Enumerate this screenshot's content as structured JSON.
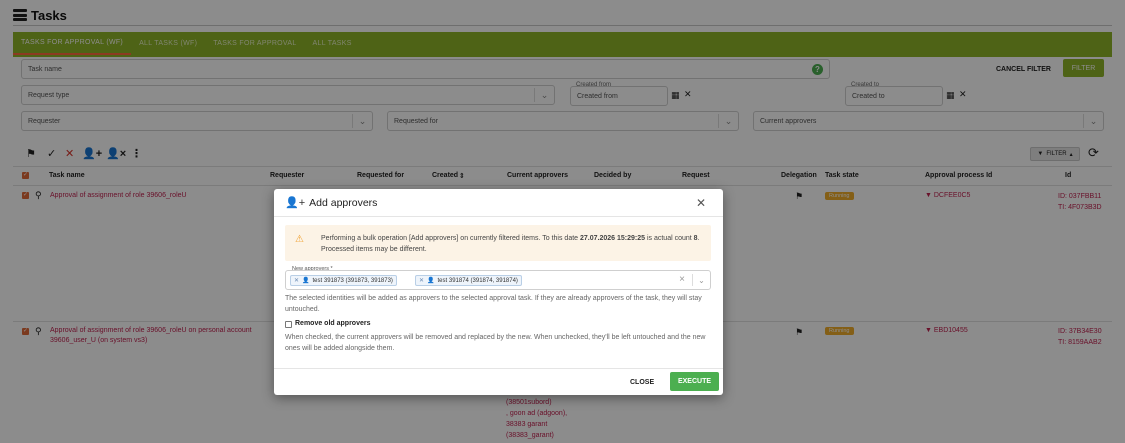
{
  "page": {
    "title": "Tasks",
    "title_icon": "tasks-list-icon"
  },
  "tabs": [
    {
      "label": "TASKS FOR APPROVAL (WF)",
      "active": true
    },
    {
      "label": "ALL TASKS (WF)",
      "active": false
    },
    {
      "label": "TASKS FOR APPROVAL",
      "active": false
    },
    {
      "label": "ALL TASKS",
      "active": false
    }
  ],
  "filters": {
    "task_name_placeholder": "Task name",
    "request_type_placeholder": "Request type",
    "created_from_label": "Created from",
    "created_from_placeholder": "Created from",
    "created_to_label": "Created to",
    "created_to_placeholder": "Created to",
    "requester_placeholder": "Requester",
    "requested_for_placeholder": "Requested for",
    "current_approvers_placeholder": "Current approvers",
    "cancel_filter_label": "CANCEL FILTER",
    "filter_button_label": "FILTER",
    "help_glyph": "?"
  },
  "toolbar": {
    "filter_toggle_label": "FILTER"
  },
  "table": {
    "headers": {
      "task_name": "Task name",
      "requester": "Requester",
      "requested_for": "Requested for",
      "created": "Created",
      "current_approvers": "Current approvers",
      "decided_by": "Decided by",
      "request": "Request",
      "delegation": "Delegation",
      "task_state": "Task state",
      "approval_process_id": "Approval process Id",
      "id": "Id"
    },
    "rows": [
      {
        "task_name": "Approval of assignment of role 39606_roleU",
        "state": "Running",
        "process_id": "DCFEE0C5",
        "id_line": "ID: 037FBB11",
        "ti_line": "TI: 4F073B3D"
      },
      {
        "task_name_line1": "Approval of assignment of role 39606_roleU on personal account",
        "task_name_line2": "39606_user_U (on system vs3)",
        "state": "Running",
        "process_id": "EBD10455",
        "id_line": "ID: 37B34E30",
        "ti_line": "TI: 8159AAB2"
      }
    ],
    "approvers_tail": [
      "(38501subord)",
      ", goon ad (adgoon),",
      "38383 garant",
      "(38383_garant)"
    ]
  },
  "modal": {
    "title": "Add approvers",
    "alert_text_before": "Performing a bulk operation [Add approvers] on currently filtered items. To this date ",
    "alert_date": "27.07.2026 15:29:25",
    "alert_text_middle": " is actual count ",
    "alert_count": "8",
    "alert_text_after": ".",
    "alert_line2": "Processed items may be different.",
    "new_approvers_label": "New approvers *",
    "chips": [
      "test 391873 (391873, 391873)",
      "test 391874 (391874, 391874)"
    ],
    "approvers_hint_line1": "The selected identities will be added as approvers to the selected approval task. If they are already approvers of the task, they will stay",
    "approvers_hint_line2": "untouched.",
    "remove_old_label": "Remove old approvers",
    "remove_hint_line1": "When checked, the current approvers will be removed and replaced by the new. When unchecked, they'll be left untouched and the new",
    "remove_hint_line2": "ones will be added alongside them.",
    "close_label": "CLOSE",
    "execute_label": "EXECUTE"
  },
  "colors": {
    "tab_bar": "#8fb428",
    "active_tab_indicator": "#ff6b3d",
    "link": "#c0214f",
    "execute": "#4caf50",
    "running_badge": "#f0ad2a"
  }
}
